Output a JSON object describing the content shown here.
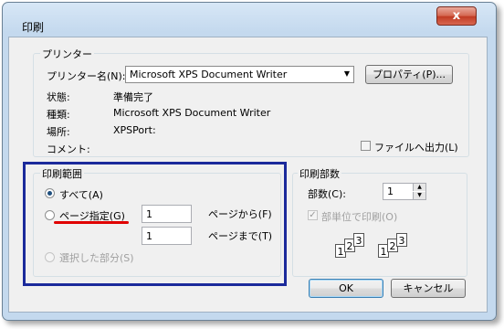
{
  "window": {
    "title": "印刷",
    "close_glyph": "x"
  },
  "printer_group": {
    "legend": "プリンター",
    "name_label": "プリンター名(N):",
    "name_value": "Microsoft XPS Document Writer",
    "properties_button": "プロパティ(P)...",
    "status_label": "状態:",
    "status_value": "準備完了",
    "type_label": "種類:",
    "type_value": "Microsoft XPS Document Writer",
    "location_label": "場所:",
    "location_value": "XPSPort:",
    "comment_label": "コメント:",
    "print_to_file_label": "ファイルへ出力(L)"
  },
  "range_group": {
    "legend": "印刷範囲",
    "all_label": "すべて(A)",
    "pages_label": "ページ指定(G)",
    "from_value": "1",
    "from_suffix": "ページから(F)",
    "to_value": "1",
    "to_suffix": "ページまで(T)",
    "selection_label": "選択した部分(S)",
    "selected_option": "all"
  },
  "copies_group": {
    "legend": "印刷部数",
    "count_label": "部数(C):",
    "count_value": "1",
    "collate_label": "部単位で印刷(O)",
    "collate_checked": true,
    "collate_pages": [
      "1",
      "2",
      "3"
    ]
  },
  "buttons": {
    "ok": "OK",
    "cancel": "キャンセル"
  },
  "annotations": {
    "highlight_box_color": "#1b2a9b",
    "underline_color": "#e00000"
  }
}
